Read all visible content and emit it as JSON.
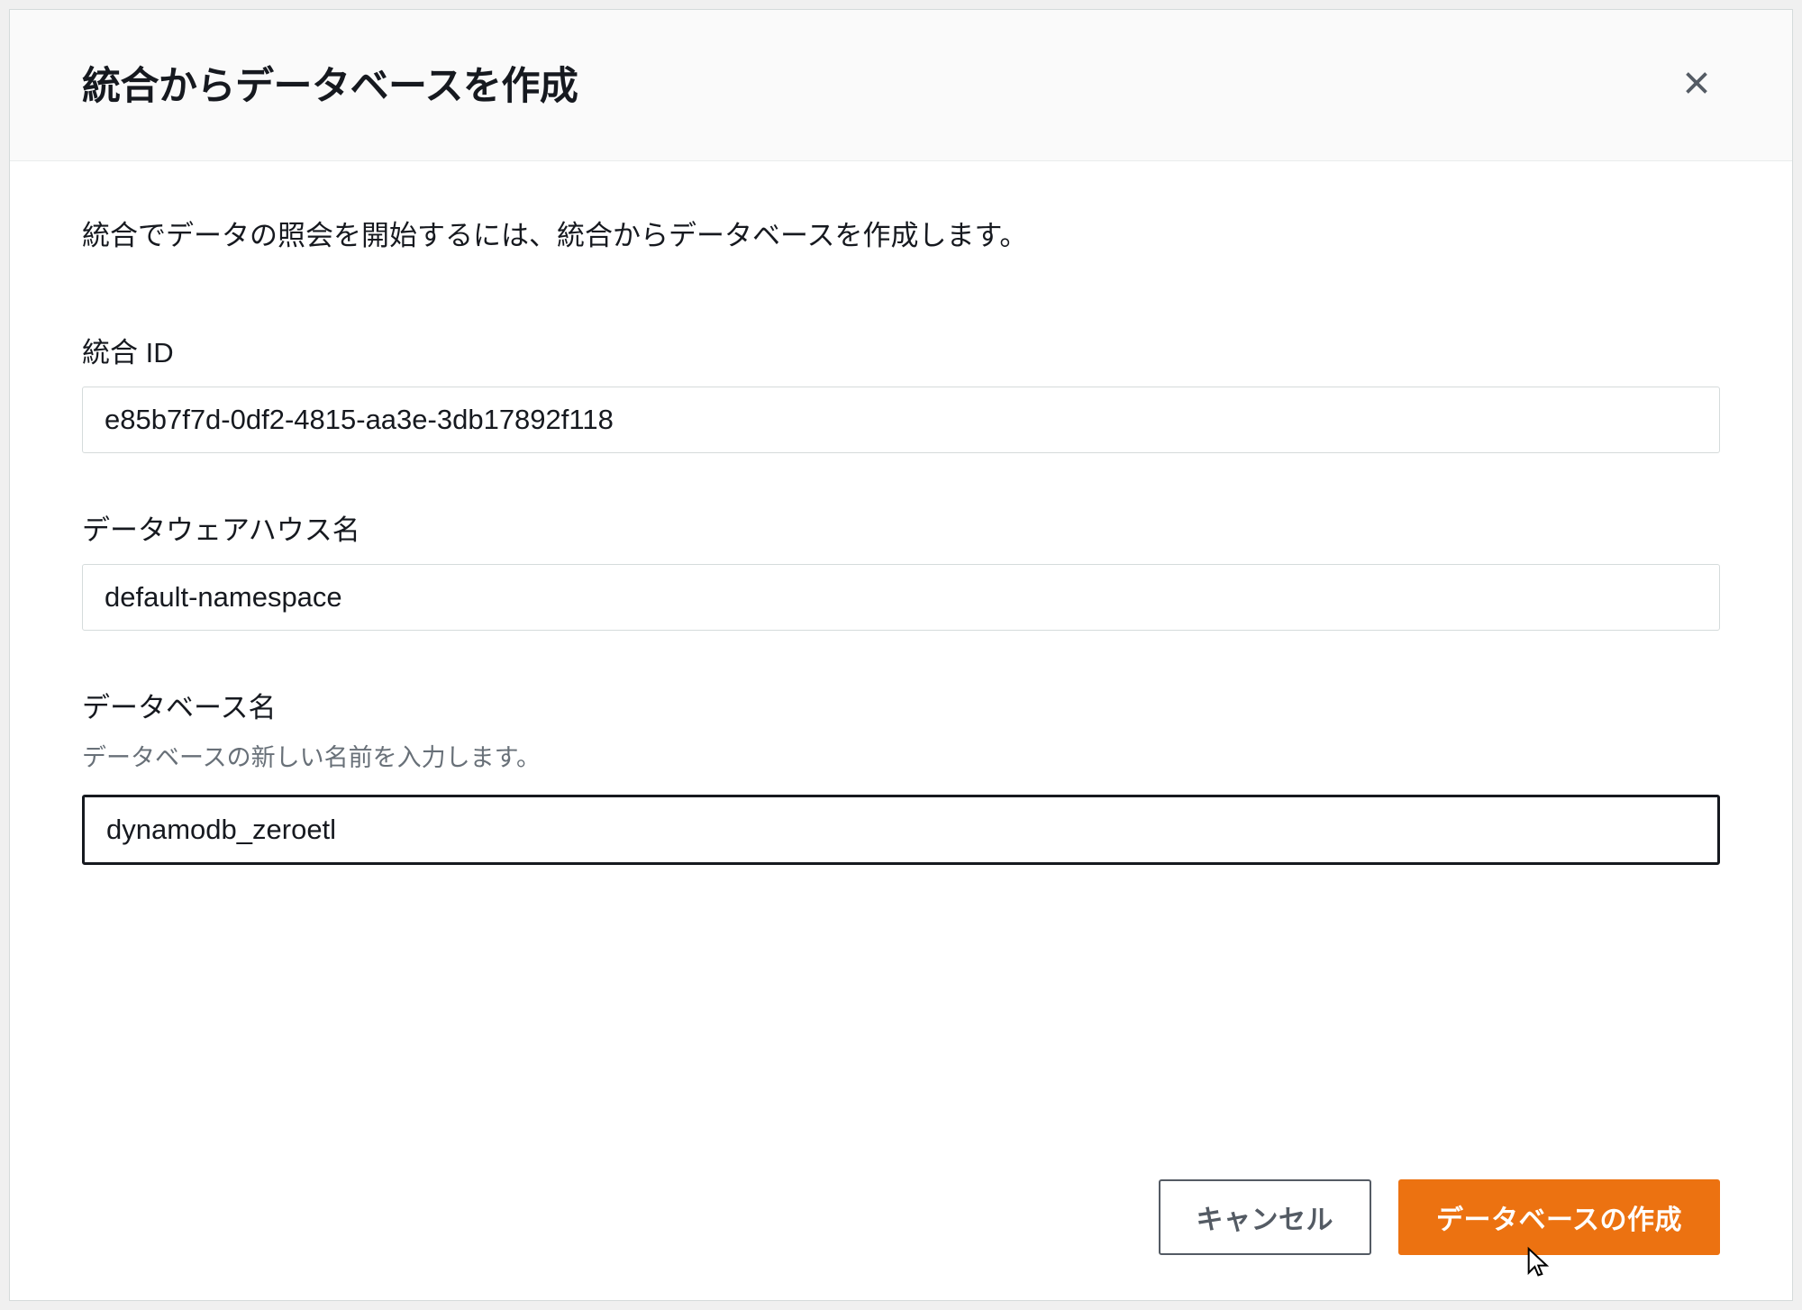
{
  "modal": {
    "title": "統合からデータベースを作成",
    "description": "統合でデータの照会を開始するには、統合からデータベースを作成します。"
  },
  "fields": {
    "integration_id": {
      "label": "統合 ID",
      "value": "e85b7f7d-0df2-4815-aa3e-3db17892f118"
    },
    "warehouse_name": {
      "label": "データウェアハウス名",
      "value": "default-namespace"
    },
    "database_name": {
      "label": "データベース名",
      "hint": "データベースの新しい名前を入力します。",
      "value": "dynamodb_zeroetl"
    }
  },
  "buttons": {
    "cancel": "キャンセル",
    "create": "データベースの作成"
  }
}
